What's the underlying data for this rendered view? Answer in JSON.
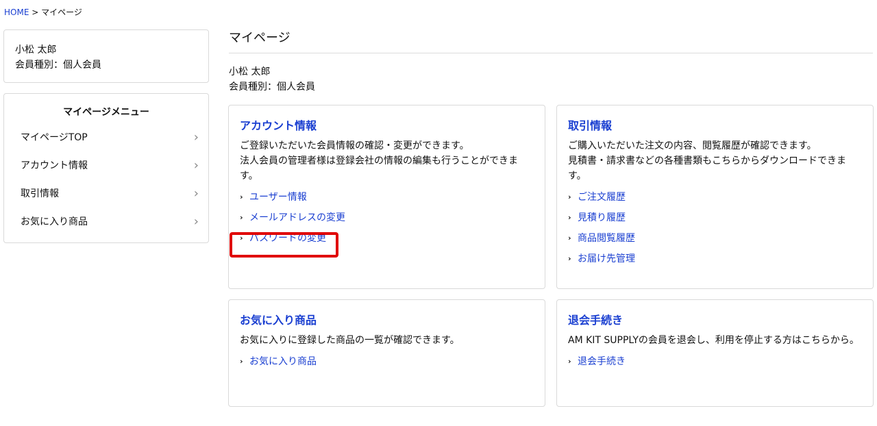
{
  "breadcrumb": {
    "home": "HOME",
    "separator": ">",
    "current": "マイページ"
  },
  "sidebar": {
    "user_name": "小松 太郎",
    "member_type": "会員種別：個人会員",
    "menu_title": "マイページメニュー",
    "items": [
      {
        "label": "マイページTOP"
      },
      {
        "label": "アカウント情報"
      },
      {
        "label": "取引情報"
      },
      {
        "label": "お気に入り商品"
      }
    ]
  },
  "main": {
    "title": "マイページ",
    "user_name": "小松 太郎",
    "member_type": "会員種別：個人会員",
    "cards": {
      "account": {
        "title": "アカウント情報",
        "desc1": "ご登録いただいた会員情報の確認・変更ができます。",
        "desc2": "法人会員の管理者様は登録会社の情報の編集も行うことができます。",
        "links": [
          "ユーザー情報",
          "メールアドレスの変更",
          "パスワードの変更"
        ]
      },
      "trade": {
        "title": "取引情報",
        "desc1": "ご購入いただいた注文の内容、閲覧履歴が確認できます。",
        "desc2": "見積書・請求書などの各種書類もこちらからダウンロードできます。",
        "links": [
          "ご注文履歴",
          "見積り履歴",
          "商品閲覧履歴",
          "お届け先管理"
        ]
      },
      "favorites": {
        "title": "お気に入り商品",
        "desc1": "お気に入りに登録した商品の一覧が確認できます。",
        "links": [
          "お気に入り商品"
        ]
      },
      "resign": {
        "title": "退会手続き",
        "desc1": "AM KIT SUPPLYの会員を退会し、利用を停止する方はこちらから。",
        "links": [
          "退会手続き"
        ]
      }
    }
  },
  "icons": {
    "chevron": "chevron-right-icon",
    "arrow": "arrow-right-icon"
  },
  "colors": {
    "link": "#1a3fd1",
    "highlight": "#e00000",
    "border": "#d9d9d9"
  }
}
